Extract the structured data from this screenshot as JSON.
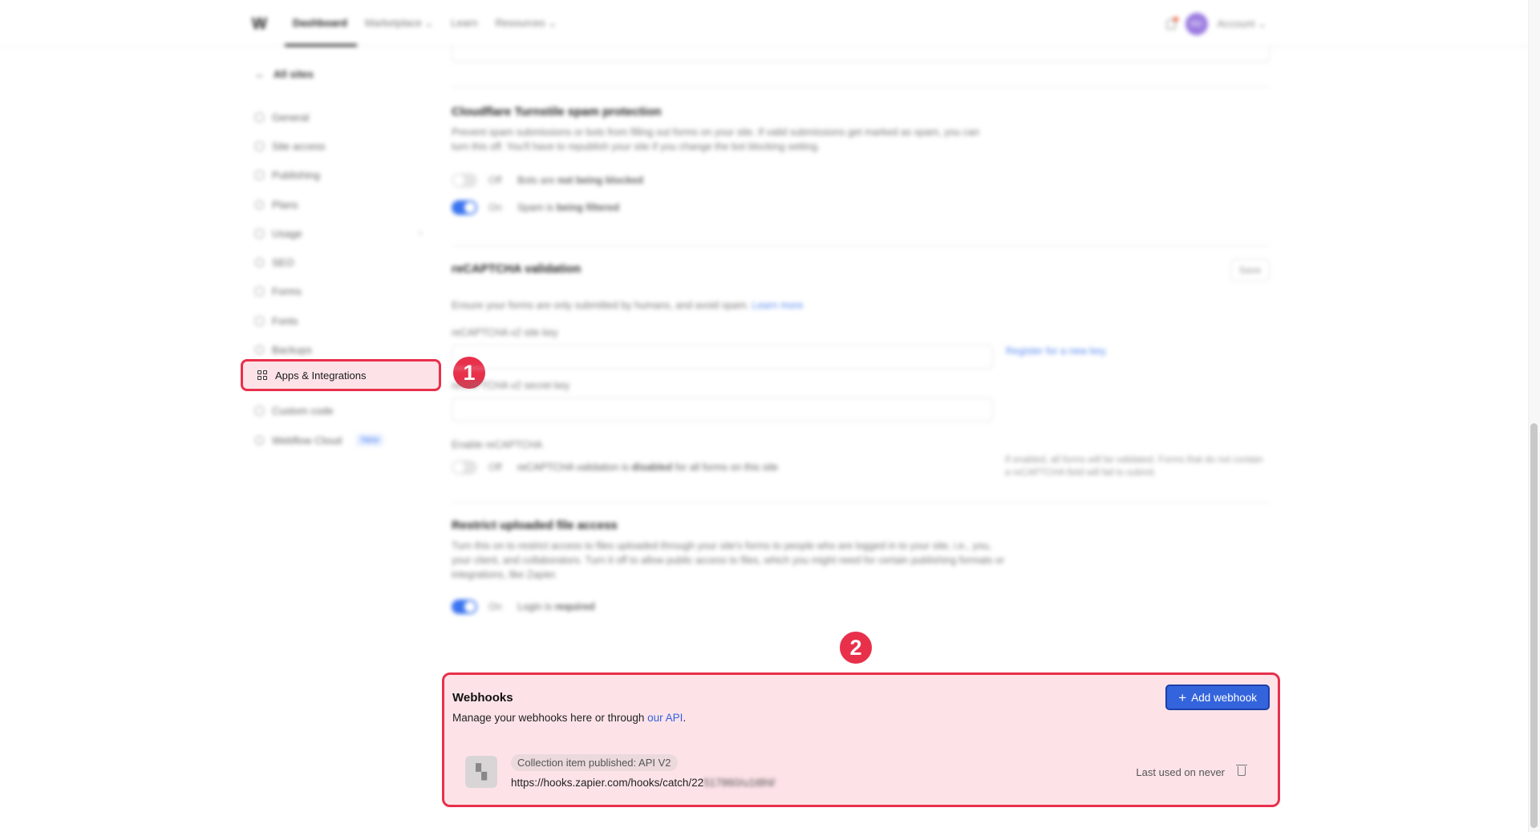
{
  "topbar": {
    "logo": "W",
    "nav": [
      "Dashboard",
      "Marketplace",
      "Learn",
      "Resources"
    ],
    "account_initials": "RD",
    "account_label": "Account"
  },
  "sidebar": {
    "back": "All sites",
    "items": [
      "General",
      "Site access",
      "Publishing",
      "Plans",
      "Usage",
      "SEO",
      "Forms",
      "Fonts",
      "Backups"
    ],
    "active": "Apps & Integrations",
    "after": [
      "Custom code",
      "Webflow Cloud"
    ],
    "new_badge": "New"
  },
  "annotations": {
    "step1": "1",
    "step2": "2"
  },
  "turnstile": {
    "title": "Cloudflare Turnstile spam protection",
    "desc": "Prevent spam submissions or bots from filling out forms on your site. If valid submissions get marked as spam, you can turn this off. You'll have to republish your site if you change the bot blocking setting.",
    "off_state": "Off",
    "off_text_a": "Bots are ",
    "off_text_b": "not being blocked",
    "on_state": "On",
    "on_text_a": "Spam is ",
    "on_text_b": "being filtered"
  },
  "recaptcha": {
    "title": "reCAPTCHA validation",
    "save": "Save",
    "desc": "Ensure your forms are only submitted by humans, and avoid spam.",
    "learn_more": "Learn more",
    "site_key_label": "reCAPTCHA v2 site key",
    "register_link": "Register for a new key.",
    "secret_key_label": "reCAPTCHA v2 secret key",
    "enable_label": "Enable reCAPTCHA",
    "enable_state": "Off",
    "enable_text_a": "reCAPTCHA validation is ",
    "enable_text_b": "disabled",
    "enable_text_c": " for all forms on this site",
    "note": "If enabled, all forms will be validated. Forms that do not contain a reCAPTCHA field will fail to submit."
  },
  "restrict": {
    "title": "Restrict uploaded file access",
    "desc": "Turn this on to restrict access to files uploaded through your site's forms to people who are logged in to your site, i.e., you, your client, and collaborators. Turn it off to allow public access to files, which you might need for certain publishing formats or integrations, like Zapier.",
    "state": "On",
    "text_a": "Login is ",
    "text_b": "required"
  },
  "webhooks": {
    "title": "Webhooks",
    "desc": "Manage your webhooks here or through ",
    "api_link": "our API",
    "desc_end": ".",
    "add_button": "Add webhook",
    "item": {
      "event": "Collection item published: API V2",
      "url_visible": "https://hooks.zapier.com/hooks/catch/22",
      "url_blurred": "517860/u1t8hl/",
      "last_used": "Last used on never"
    }
  }
}
